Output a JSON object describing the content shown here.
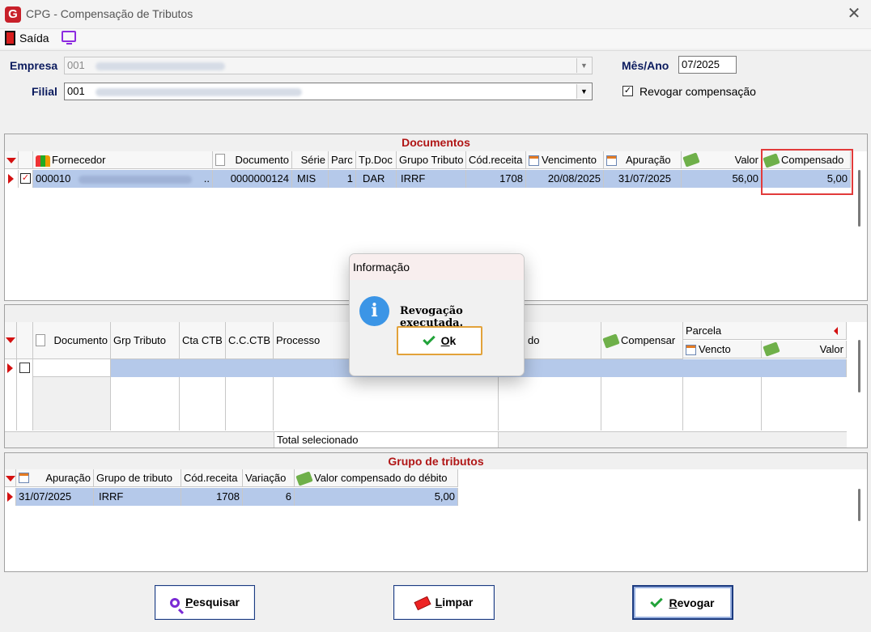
{
  "window": {
    "title": "CPG - Compensação de Tributos",
    "close": "✕",
    "app_icon": "G"
  },
  "menu": {
    "exit_label": "Saída"
  },
  "filters": {
    "empresa_label": "Empresa",
    "empresa_value": "001",
    "filial_label": "Filial",
    "filial_value": "001",
    "mes_ano_label": "Mês/Ano",
    "mes_ano_value": "07/2025",
    "revogar_label": "Revogar compensação",
    "revogar_checked": "✓"
  },
  "documentos": {
    "title": "Documentos",
    "columns": [
      "Fornecedor",
      "Documento",
      "Série",
      "Parc",
      "Tp.Doc",
      "Grupo Tributo",
      "Cód.receita",
      "Vencimento",
      "Apuração",
      "Valor",
      "Compensado"
    ],
    "row": {
      "checked": "✓",
      "fornecedor_code": "000010",
      "fornecedor_tail": "..",
      "documento": "0000000124",
      "serie": "MIS",
      "parc": "1",
      "tp_doc": "DAR",
      "grupo_tributo": "IRRF",
      "cod_receita": "1708",
      "vencimento": "20/08/2025",
      "apuracao": "31/07/2025",
      "valor": "56,00",
      "compensado": "5,00"
    }
  },
  "middle": {
    "columns": [
      "Documento",
      "Grp Tributo",
      "Cta CTB",
      "C.C.CTB",
      "Processo",
      "do",
      "Compensar"
    ],
    "parcela_label": "Parcela",
    "vencto_label": "Vencto",
    "valor_label": "Valor",
    "total_label": "Total selecionado"
  },
  "grupo": {
    "title": "Grupo de tributos",
    "columns": [
      "Apuração",
      "Grupo de tributo",
      "Cód.receita",
      "Variação",
      "Valor compensado do débito"
    ],
    "row": {
      "apuracao": "31/07/2025",
      "grupo": "IRRF",
      "cod_receita": "1708",
      "variacao": "6",
      "valor": "5,00"
    }
  },
  "buttons": {
    "pesquisar_first": "P",
    "pesquisar_rest": "esquisar",
    "limpar_first": "L",
    "limpar_rest": "impar",
    "revogar_first": "R",
    "revogar_rest": "evogar"
  },
  "dialog": {
    "title": "Informação",
    "icon": "i",
    "message": "Revogação executada.",
    "ok_first": "O",
    "ok_rest": "k"
  }
}
